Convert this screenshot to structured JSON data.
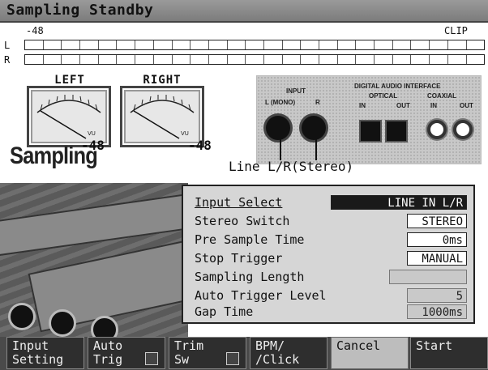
{
  "window": {
    "title": "Sampling Standby"
  },
  "level_meter": {
    "scale_min": "-48",
    "scale_max": "CLIP",
    "channels": [
      "L",
      "R"
    ]
  },
  "vu_meters": {
    "left": {
      "label": "LEFT",
      "value": "-48"
    },
    "right": {
      "label": "RIGHT",
      "value": "-48"
    }
  },
  "input_panel": {
    "input_title": "INPUT",
    "jack_l": "L (MONO)",
    "jack_r": "R",
    "digital_title": "DIGITAL AUDIO INTERFACE",
    "optical": "OPTICAL",
    "coaxial": "COAXIAL",
    "in": "IN",
    "out": "OUT"
  },
  "logo": "Sampling",
  "input_callout": "Line L/R(Stereo)",
  "settings": {
    "rows": [
      {
        "label": "Input Select",
        "value": "LINE IN L/R"
      },
      {
        "label": "Stereo Switch",
        "value": "STEREO"
      },
      {
        "label": "Pre Sample Time",
        "value": "0ms"
      },
      {
        "label": "Stop Trigger",
        "value": "MANUAL"
      },
      {
        "label": "Sampling Length",
        "value": ""
      },
      {
        "label": "Auto Trigger Level",
        "value": "5"
      },
      {
        "label": "Gap Time",
        "value": "1000ms"
      }
    ]
  },
  "function_bar": {
    "input_setting": [
      "Input",
      "Setting"
    ],
    "auto_trig": [
      "Auto",
      "Trig"
    ],
    "trim_sw": [
      "Trim",
      "Sw"
    ],
    "bpm_click": [
      "BPM/",
      "/Click"
    ],
    "cancel": "Cancel",
    "start": "Start"
  }
}
